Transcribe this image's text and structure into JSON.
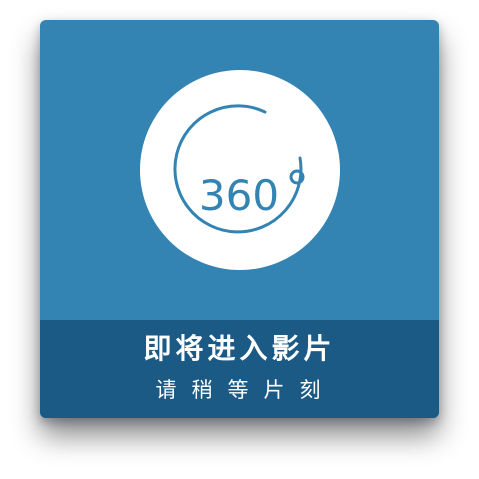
{
  "splash": {
    "badge_text": "360",
    "title": "即将进入影片",
    "subtitle": "请稍等片刻"
  },
  "colors": {
    "card_bg": "#3383b3",
    "footer_bg": "#1c5a86",
    "disc": "#ffffff"
  },
  "icons": {
    "badge": "360-degree-icon"
  }
}
